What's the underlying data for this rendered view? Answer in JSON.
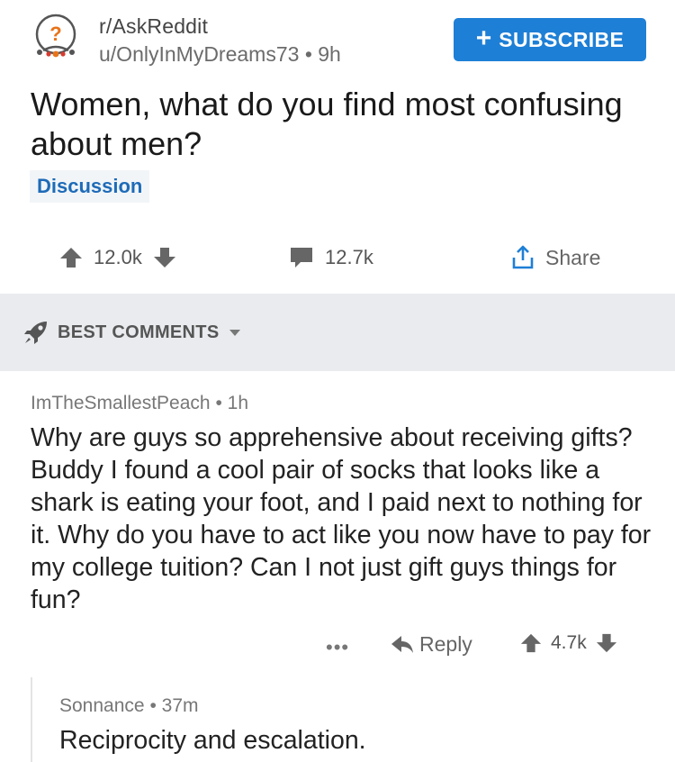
{
  "post": {
    "subreddit": "r/AskReddit",
    "author": "u/OnlyInMyDreams73",
    "age": "9h",
    "subscribe_label": "SUBSCRIBE",
    "title": "Women, what do you find most confusing about men?",
    "flair": "Discussion",
    "score": "12.0k",
    "comment_count": "12.7k",
    "share_label": "Share"
  },
  "sort": {
    "label": "BEST COMMENTS"
  },
  "comment": {
    "author": "ImTheSmallestPeach",
    "age": "1h",
    "body": "Why are guys so apprehensive about receiving gifts? Buddy I found a cool pair of socks that looks like a shark is eating your foot, and I paid next to nothing for it. Why do you have to act like you now have to pay for my college tuition? Can I not just gift guys things for fun?",
    "more": "•••",
    "reply_label": "Reply",
    "score": "4.7k"
  },
  "reply": {
    "author": "Sonnance",
    "age": "37m",
    "body": "Reciprocity and escalation."
  },
  "colors": {
    "accent": "#1e7fd6",
    "sort_bar_bg": "#e9ebee",
    "flair_text": "#1e6bb8"
  },
  "separator": "•",
  "icons": [
    "subreddit-avatar-icon",
    "plus-icon",
    "upvote-icon",
    "downvote-icon",
    "comment-icon",
    "share-icon",
    "rocket-icon",
    "caret-down-icon",
    "reply-arrow-icon"
  ]
}
